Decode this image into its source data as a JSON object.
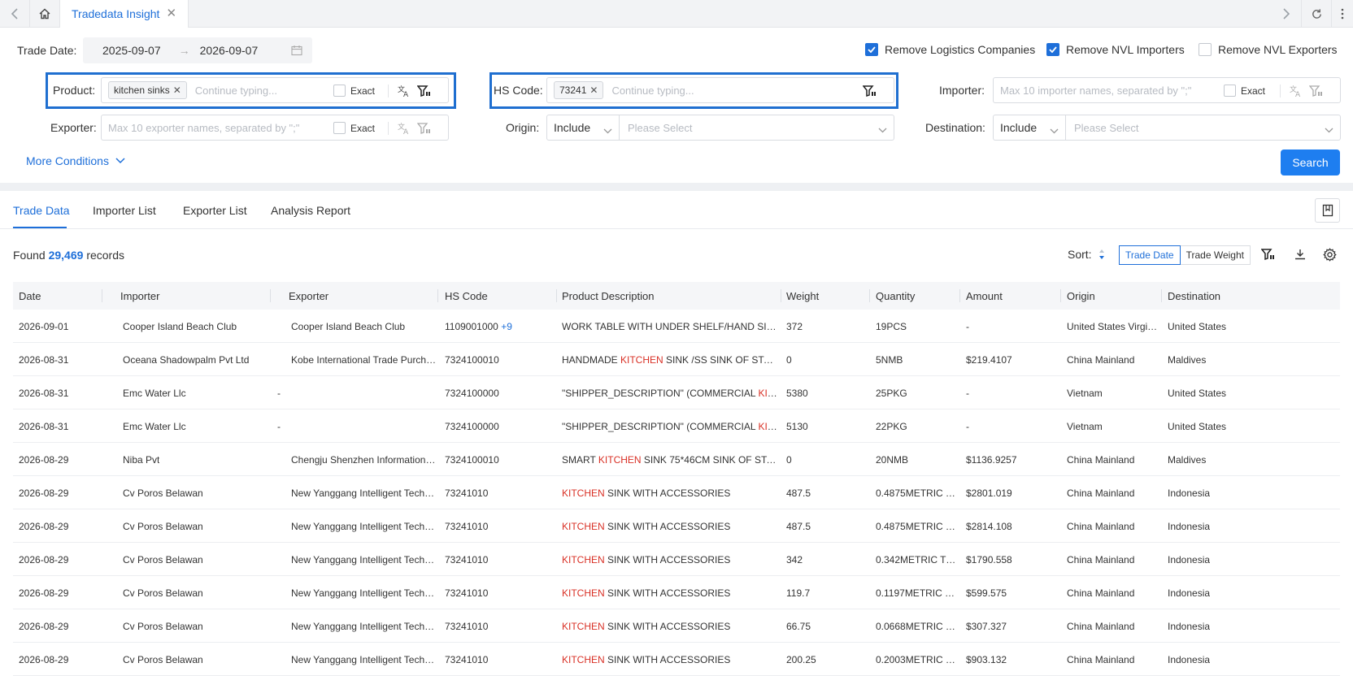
{
  "tabbar": {
    "tab_title": "Tradedata Insight"
  },
  "filters": {
    "trade_date_label": "Trade Date:",
    "date_from": "2025-09-07",
    "date_to": "2026-09-07",
    "remove_logistics": {
      "label": "Remove Logistics Companies",
      "checked": true
    },
    "remove_nvl_importers": {
      "label": "Remove NVL Importers",
      "checked": true
    },
    "remove_nvl_exporters": {
      "label": "Remove NVL Exporters",
      "checked": false
    },
    "product": {
      "label": "Product:",
      "tag": "kitchen sinks",
      "placeholder": "Continue typing...",
      "exact_label": "Exact"
    },
    "hs_code": {
      "label": "HS Code:",
      "tag": "73241",
      "placeholder": "Continue typing..."
    },
    "importer": {
      "label": "Importer:",
      "placeholder": "Max 10 importer names, separated by \";\"",
      "exact_label": "Exact"
    },
    "exporter": {
      "label": "Exporter:",
      "placeholder": "Max 10 exporter names, separated by \";\"",
      "exact_label": "Exact"
    },
    "origin": {
      "label": "Origin:",
      "mode": "Include",
      "placeholder": "Please Select"
    },
    "destination": {
      "label": "Destination:",
      "mode": "Include",
      "placeholder": "Please Select"
    },
    "more_conditions": "More Conditions",
    "search_button": "Search"
  },
  "subtabs": [
    "Trade Data",
    "Importer List",
    "Exporter List",
    "Analysis Report"
  ],
  "results": {
    "found_prefix": "Found",
    "count": "29,469",
    "found_suffix": "records"
  },
  "sort": {
    "label": "Sort:",
    "options": [
      "Trade Date",
      "Trade Weight"
    ],
    "active": "Trade Date"
  },
  "table": {
    "columns": [
      "Date",
      "Importer",
      "Exporter",
      "HS Code",
      "Product Description",
      "Weight",
      "Quantity",
      "Amount",
      "Origin",
      "Destination"
    ],
    "rows": [
      {
        "date": "2026-09-01",
        "importer": "Cooper Island Beach Club",
        "exporter": "Cooper Island Beach Club",
        "hs": "1109001000",
        "hs_extra": "+9",
        "desc_pre": "WORK TABLE WITH UNDER SHELF/HAND SINK SH...",
        "desc_hl": "",
        "desc_post": "",
        "weight": "372",
        "qty": "19PCS",
        "amount": "-",
        "origin": "United States Virgin...",
        "dest": "United States"
      },
      {
        "date": "2026-08-31",
        "importer": "Oceana Shadowpalm Pvt Ltd",
        "exporter": "Kobe International Trade Purchas...",
        "hs": "7324100010",
        "hs_extra": "",
        "desc_pre": "HANDMADE ",
        "desc_hl": "KITCHEN",
        "desc_post": " SINK /SS SINK OF STAINLES...",
        "weight": "0",
        "qty": "5NMB",
        "amount": "$219.4107",
        "origin": "China Mainland",
        "dest": "Maldives"
      },
      {
        "date": "2026-08-31",
        "importer": "Emc Water Llc",
        "exporter": "-",
        "hs": "7324100000",
        "hs_extra": "",
        "desc_pre": "\"SHIPPER_DESCRIPTION\" (COMMERCIAL ",
        "desc_hl": "KITCHEN",
        "desc_post": " ...",
        "weight": "5380",
        "qty": "25PKG",
        "amount": "-",
        "origin": "Vietnam",
        "dest": "United States"
      },
      {
        "date": "2026-08-31",
        "importer": "Emc Water Llc",
        "exporter": "-",
        "hs": "7324100000",
        "hs_extra": "",
        "desc_pre": "\"SHIPPER_DESCRIPTION\" (COMMERCIAL ",
        "desc_hl": "KITCHEN",
        "desc_post": " ...",
        "weight": "5130",
        "qty": "22PKG",
        "amount": "-",
        "origin": "Vietnam",
        "dest": "United States"
      },
      {
        "date": "2026-08-29",
        "importer": "Niba Pvt",
        "exporter": "Chengju Shenzhen Information T...",
        "hs": "7324100010",
        "hs_extra": "",
        "desc_pre": "SMART ",
        "desc_hl": "KITCHEN",
        "desc_post": " SINK 75*46CM SINK OF STAINLE...",
        "weight": "0",
        "qty": "20NMB",
        "amount": "$1136.9257",
        "origin": "China Mainland",
        "dest": "Maldives"
      },
      {
        "date": "2026-08-29",
        "importer": "Cv Poros Belawan",
        "exporter": "New Yanggang Intelligent Techn...",
        "hs": "73241010",
        "hs_extra": "",
        "desc_pre": "",
        "desc_hl": "KITCHEN",
        "desc_post": " SINK WITH ACCESSORIES",
        "weight": "487.5",
        "qty": "0.4875METRIC T...",
        "amount": "$2801.019",
        "origin": "China Mainland",
        "dest": "Indonesia"
      },
      {
        "date": "2026-08-29",
        "importer": "Cv Poros Belawan",
        "exporter": "New Yanggang Intelligent Techn...",
        "hs": "73241010",
        "hs_extra": "",
        "desc_pre": "",
        "desc_hl": "KITCHEN",
        "desc_post": " SINK WITH ACCESSORIES",
        "weight": "487.5",
        "qty": "0.4875METRIC T...",
        "amount": "$2814.108",
        "origin": "China Mainland",
        "dest": "Indonesia"
      },
      {
        "date": "2026-08-29",
        "importer": "Cv Poros Belawan",
        "exporter": "New Yanggang Intelligent Techn...",
        "hs": "73241010",
        "hs_extra": "",
        "desc_pre": "",
        "desc_hl": "KITCHEN",
        "desc_post": " SINK WITH ACCESSORIES",
        "weight": "342",
        "qty": "0.342METRIC TO...",
        "amount": "$1790.558",
        "origin": "China Mainland",
        "dest": "Indonesia"
      },
      {
        "date": "2026-08-29",
        "importer": "Cv Poros Belawan",
        "exporter": "New Yanggang Intelligent Techn...",
        "hs": "73241010",
        "hs_extra": "",
        "desc_pre": "",
        "desc_hl": "KITCHEN",
        "desc_post": " SINK WITH ACCESSORIES",
        "weight": "119.7",
        "qty": "0.1197METRIC T...",
        "amount": "$599.575",
        "origin": "China Mainland",
        "dest": "Indonesia"
      },
      {
        "date": "2026-08-29",
        "importer": "Cv Poros Belawan",
        "exporter": "New Yanggang Intelligent Techn...",
        "hs": "73241010",
        "hs_extra": "",
        "desc_pre": "",
        "desc_hl": "KITCHEN",
        "desc_post": " SINK WITH ACCESSORIES",
        "weight": "66.75",
        "qty": "0.0668METRIC T...",
        "amount": "$307.327",
        "origin": "China Mainland",
        "dest": "Indonesia"
      },
      {
        "date": "2026-08-29",
        "importer": "Cv Poros Belawan",
        "exporter": "New Yanggang Intelligent Techn...",
        "hs": "73241010",
        "hs_extra": "",
        "desc_pre": "",
        "desc_hl": "KITCHEN",
        "desc_post": " SINK WITH ACCESSORIES",
        "weight": "200.25",
        "qty": "0.2003METRIC T...",
        "amount": "$903.132",
        "origin": "China Mainland",
        "dest": "Indonesia"
      }
    ]
  }
}
